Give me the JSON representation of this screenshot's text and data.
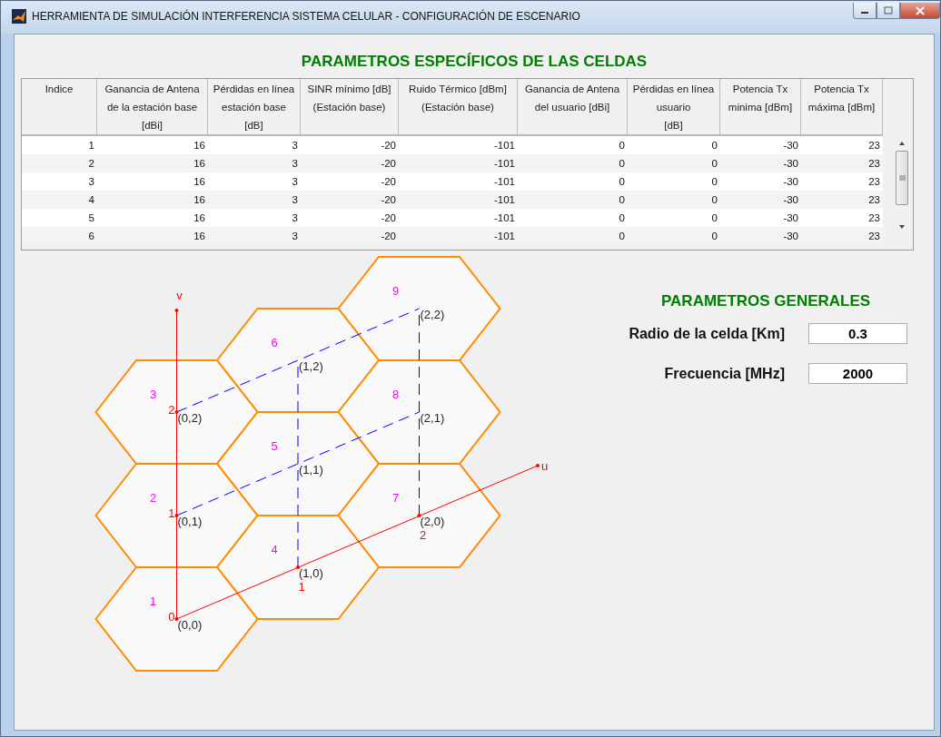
{
  "window": {
    "title": "HERRAMIENTA DE SIMULACIÓN INTERFERENCIA SISTEMA CELULAR - CONFIGURACIÓN DE ESCENARIO"
  },
  "cell_table": {
    "title": "PARAMETROS ESPECÍFICOS DE LAS CELDAS",
    "columns": [
      "Indice",
      "Ganancia de Antena\nde la estación base\n[dBi]",
      "Pérdidas en línea\nestación base\n[dB]",
      "SINR mínimo [dB]\n(Estación base)",
      "Ruido Térmico [dBm]\n(Estación base)",
      "Ganancia de Antena\ndel usuario [dBi]",
      "Pérdidas en línea\nusuario\n[dB]",
      "Potencia Tx\nminima [dBm]",
      "Potencia Tx\nmáxima [dBm]"
    ],
    "rows": [
      [
        "1",
        "16",
        "3",
        "-20",
        "-101",
        "0",
        "0",
        "-30",
        "23"
      ],
      [
        "2",
        "16",
        "3",
        "-20",
        "-101",
        "0",
        "0",
        "-30",
        "23"
      ],
      [
        "3",
        "16",
        "3",
        "-20",
        "-101",
        "0",
        "0",
        "-30",
        "23"
      ],
      [
        "4",
        "16",
        "3",
        "-20",
        "-101",
        "0",
        "0",
        "-30",
        "23"
      ],
      [
        "5",
        "16",
        "3",
        "-20",
        "-101",
        "0",
        "0",
        "-30",
        "23"
      ],
      [
        "6",
        "16",
        "3",
        "-20",
        "-101",
        "0",
        "0",
        "-30",
        "23"
      ]
    ]
  },
  "diagram": {
    "cells": [
      {
        "label": "9"
      },
      {
        "label": "6"
      },
      {
        "label": "3"
      },
      {
        "label": "8"
      },
      {
        "label": "5"
      },
      {
        "label": "2"
      },
      {
        "label": "7"
      },
      {
        "label": "4"
      },
      {
        "label": "1"
      }
    ],
    "points": [
      {
        "label": "(2,2)"
      },
      {
        "label": "(1,2)"
      },
      {
        "label": "(0,2)"
      },
      {
        "label": "(2,1)"
      },
      {
        "label": "(1,1)"
      },
      {
        "label": "(0,1)"
      },
      {
        "label": "(2,0)"
      },
      {
        "label": "(1,0)"
      },
      {
        "label": "(0,0)"
      }
    ],
    "u_axis": {
      "label": "u",
      "ticks": [
        "2",
        "1"
      ]
    },
    "v_axis": {
      "label": "v",
      "ticks": [
        "2",
        "1",
        "0"
      ]
    }
  },
  "general": {
    "title": "PARAMETROS GENERALES",
    "fields": [
      {
        "label": "Radio de la celda [Km]",
        "value": "0.3"
      },
      {
        "label": "Frecuencia [MHz]",
        "value": "2000"
      }
    ]
  }
}
